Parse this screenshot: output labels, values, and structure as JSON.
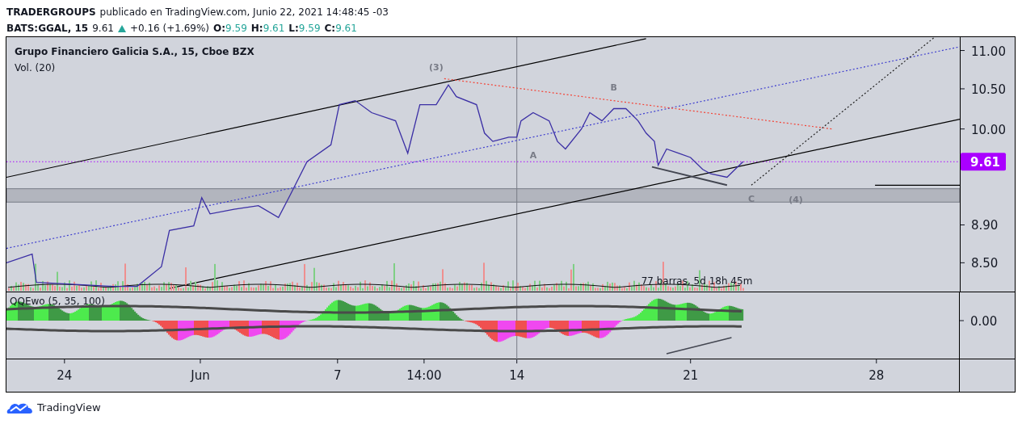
{
  "header": {
    "publisher": "TRADERGROUPS",
    "byline": "publicado en TradingView.com, Junio 22, 2021 14:48:45 -03"
  },
  "quote": {
    "symbol": "BATS:GGAL, 15",
    "last": "9.61",
    "change": "+0.16 (+1.69%)",
    "ohlc": [
      {
        "label": "O:",
        "value": "9.59"
      },
      {
        "label": "H:",
        "value": "9.61"
      },
      {
        "label": "L:",
        "value": "9.59"
      },
      {
        "label": "C:",
        "value": "9.61"
      }
    ]
  },
  "chart": {
    "title": "Grupo Financiero Galicia S.A., 15, Cboe BZX",
    "volume_legend": "Vol. (20)",
    "last_price_badge": "9.61",
    "measure_label": "77 barras, 5d 18h 45m",
    "wave_labels": [
      "(3)",
      "A",
      "B",
      "C",
      "(4)"
    ],
    "price_axis_labels": [
      "11.00",
      "10.50",
      "10.00",
      "8.90",
      "8.50"
    ]
  },
  "indicator": {
    "legend": "QQEwo (5, 35, 100)",
    "zero_tick": "0.00"
  },
  "time_axis": {
    "labels": [
      "24",
      "Jun",
      "7",
      "14:00",
      "14",
      "21",
      "28"
    ]
  },
  "footer": {
    "brand": "TradingView"
  }
}
